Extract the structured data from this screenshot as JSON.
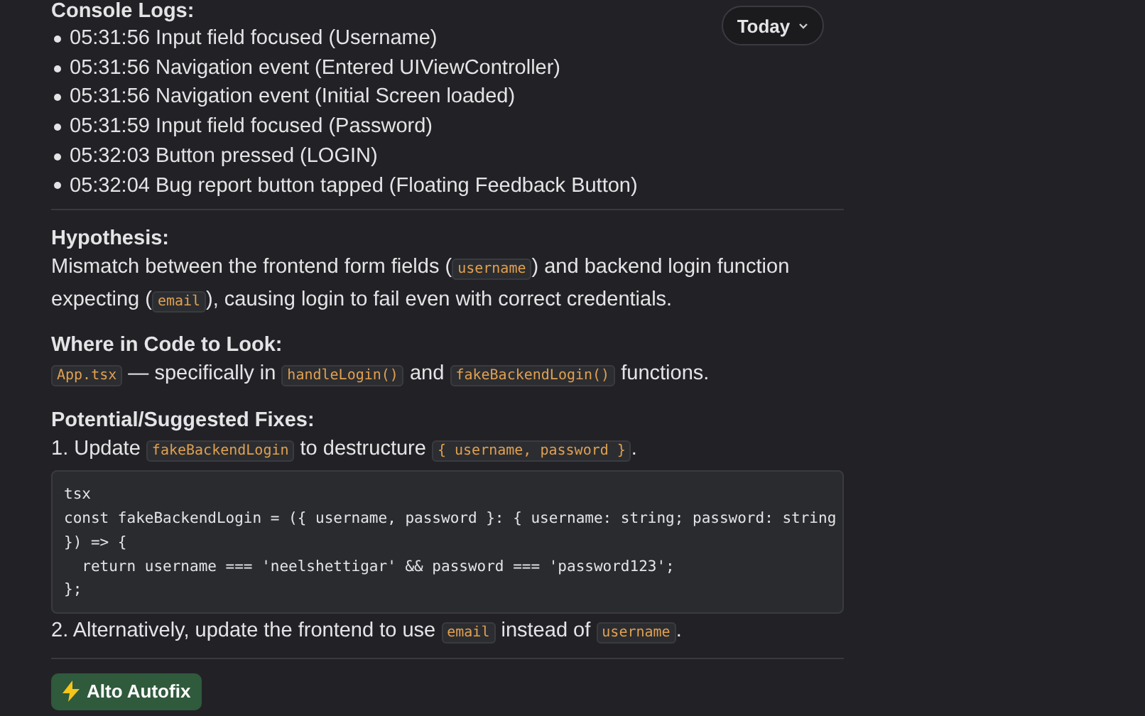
{
  "date_filter": {
    "label": "Today"
  },
  "console_logs": {
    "heading": "Console Logs:",
    "entries": [
      "05:31:56 Input field focused (Username)",
      "05:31:56 Navigation event (Entered UIViewController)",
      "05:31:56 Navigation event (Initial Screen loaded)",
      "05:31:59 Input field focused (Password)",
      "05:32:03 Button pressed (LOGIN)",
      "05:32:04 Bug report button tapped (Floating Feedback Button)"
    ]
  },
  "sections": [
    {
      "heading": "Hypothesis:",
      "blocks": [
        {
          "kind": "paragraph",
          "segments": [
            {
              "kind": "text",
              "text": "Mismatch between the frontend form fields ("
            },
            {
              "kind": "code",
              "text": "username"
            },
            {
              "kind": "text",
              "text": ") and backend login function expecting ("
            },
            {
              "kind": "code",
              "text": "email"
            },
            {
              "kind": "text",
              "text": "), causing login to fail even with correct credentials."
            }
          ]
        }
      ]
    },
    {
      "heading": "Where in Code to Look:",
      "blocks": [
        {
          "kind": "paragraph",
          "segments": [
            {
              "kind": "code",
              "text": "App.tsx"
            },
            {
              "kind": "text",
              "text": " — specifically in "
            },
            {
              "kind": "code",
              "text": "handleLogin()"
            },
            {
              "kind": "text",
              "text": " and "
            },
            {
              "kind": "code",
              "text": "fakeBackendLogin()"
            },
            {
              "kind": "text",
              "text": " functions."
            }
          ]
        }
      ]
    },
    {
      "heading": "Potential/Suggested Fixes:",
      "blocks": [
        {
          "kind": "paragraph",
          "segments": [
            {
              "kind": "text",
              "text": "1. Update "
            },
            {
              "kind": "code",
              "text": "fakeBackendLogin"
            },
            {
              "kind": "text",
              "text": " to destructure "
            },
            {
              "kind": "code",
              "text": "{ username, password }"
            },
            {
              "kind": "text",
              "text": "."
            }
          ]
        },
        {
          "kind": "codeblock",
          "lines": [
            "tsx",
            "const fakeBackendLogin = ({ username, password }: { username: string; password: string",
            "}) => {",
            "  return username === 'neelshettigar' && password === 'password123';",
            "};"
          ]
        },
        {
          "kind": "paragraph",
          "segments": [
            {
              "kind": "text",
              "text": "2. Alternatively, update the frontend to use "
            },
            {
              "kind": "code",
              "text": "email"
            },
            {
              "kind": "text",
              "text": " instead of "
            },
            {
              "kind": "code",
              "text": "username"
            },
            {
              "kind": "text",
              "text": "."
            }
          ]
        }
      ]
    }
  ],
  "autofix_button": {
    "label": "Alto Autofix"
  }
}
